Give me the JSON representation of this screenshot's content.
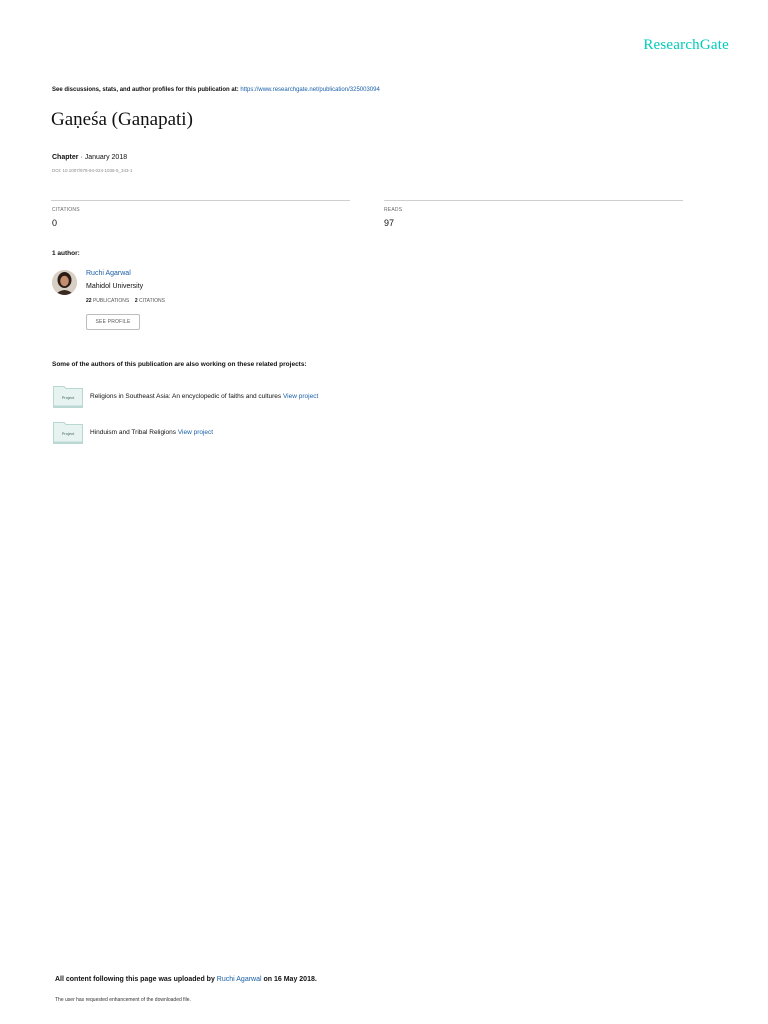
{
  "header": {
    "logo_text": "ResearchGate",
    "logo_color": "#00ccbb",
    "discussions_text": "See discussions, stats, and author profiles for this publication at:",
    "publication_url": "https://www.researchgate.net/publication/325003094"
  },
  "publication": {
    "title": "Gaṇeśa (Gaṇapati)",
    "type": "Chapter",
    "separator": " · ",
    "date": "January 2018",
    "doi": "DOI: 10.1007/978-94-024-1036-5_343-1"
  },
  "stats": {
    "citations_label": "CITATIONS",
    "citations_value": "0",
    "reads_label": "READS",
    "reads_value": "97"
  },
  "authors": {
    "heading": "1 author:",
    "items": [
      {
        "name": "Ruchi Agarwal",
        "institution": "Mahidol University",
        "publications_count": "22",
        "publications_label": "PUBLICATIONS",
        "citations_count": "2",
        "citations_label": "CITATIONS",
        "see_profile_label": "SEE PROFILE"
      }
    ]
  },
  "projects": {
    "heading": "Some of the authors of this publication are also working on these related projects:",
    "folder_label": "Project",
    "items": [
      {
        "title": "Religions in Southeast Asia: An encyclopedic of faiths and cultures",
        "link_label": "View project"
      },
      {
        "title": "Hinduism and Tribal Religions",
        "link_label": "View project"
      }
    ]
  },
  "footer": {
    "upload_prefix": "All content following this page was uploaded by",
    "uploader": "Ruchi Agarwal",
    "upload_suffix": "on 16 May 2018.",
    "note": "The user has requested enhancement of the downloaded file."
  }
}
